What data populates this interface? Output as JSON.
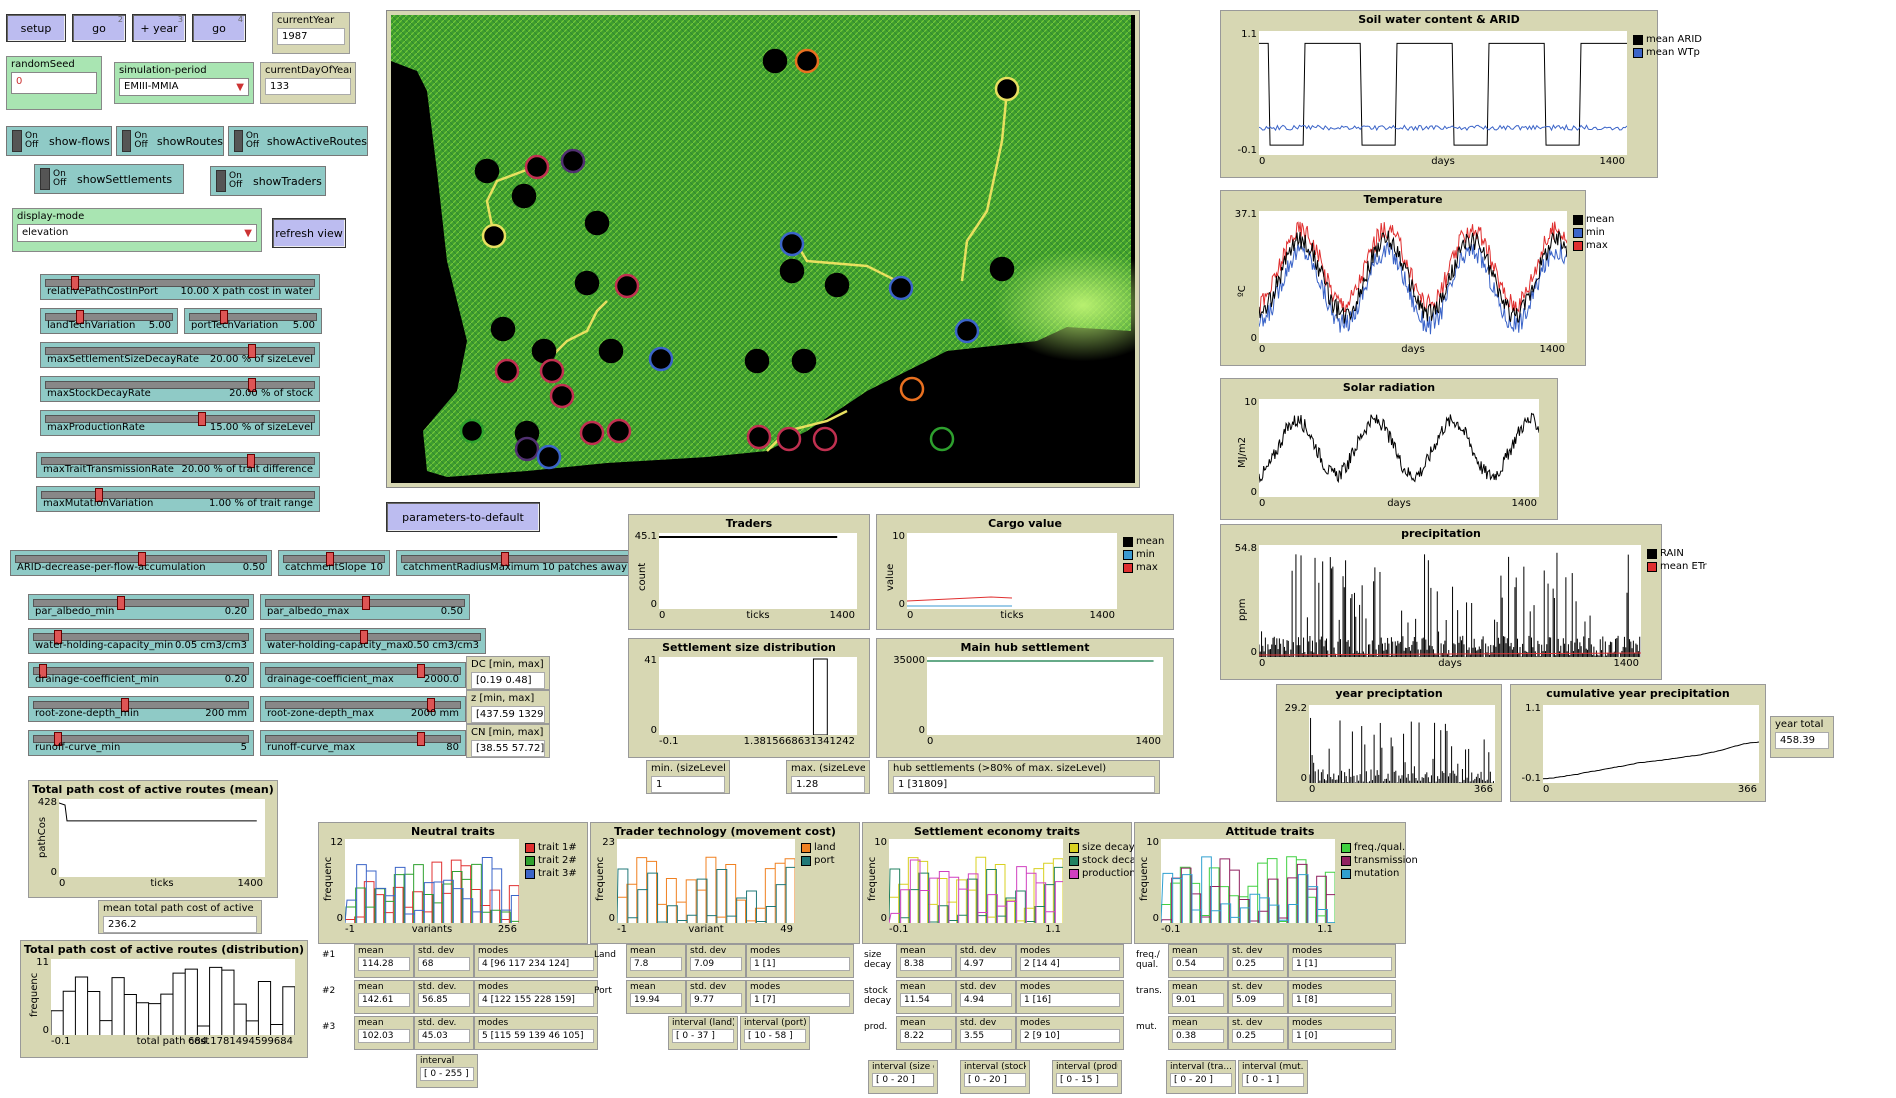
{
  "buttons": {
    "setup": "setup",
    "go": "go",
    "go_key": "2",
    "plus_year": "+ year",
    "plus_year_key": "3",
    "go_forever": "go",
    "go_forever_key": "4",
    "refresh": "refresh view",
    "defaults": "parameters-to-default"
  },
  "monitors": {
    "currentYear": {
      "label": "currentYear",
      "value": "1987"
    },
    "currentDay": {
      "label": "currentDayOfYear",
      "value": "133"
    },
    "yearTotal": {
      "label": "year total",
      "value": "458.39"
    },
    "minSize": {
      "label": "min. (sizeLevel)",
      "value": "1"
    },
    "maxSize": {
      "label": "max. (sizeLevel)",
      "value": "1.28"
    },
    "hub": {
      "label": "hub settlements (>80% of max. sizeLevel)",
      "value": "1 [31809]"
    },
    "meanPath": {
      "label": "mean total path cost of active routes",
      "value": "236.2"
    },
    "DC": {
      "label": "DC [min, max]",
      "value": "[0.19 0.48]"
    },
    "z": {
      "label": "z [min, max]",
      "value": "[437.59 1329.36]"
    },
    "CN": {
      "label": "CN [min, max]",
      "value": "[38.55 57.72]"
    }
  },
  "inputs": {
    "randomSeed": {
      "label": "randomSeed",
      "value": "0"
    }
  },
  "choosers": {
    "period": {
      "label": "simulation-period",
      "value": "EMIII-MMIA"
    },
    "display": {
      "label": "display-mode",
      "value": "elevation"
    }
  },
  "switches": {
    "on": "On",
    "off": "Off",
    "flows": "show-flows",
    "routes": "showRoutes",
    "active": "showActiveRoutes",
    "settlements": "showSettlements",
    "traders": "showTraders"
  },
  "sliders": {
    "s1": {
      "name": "relativePathCostInPort",
      "value": "10.00 X path cost in water",
      "level": 0.1
    },
    "s2": {
      "name": "landTechVariation",
      "value": "5.00",
      "level": 0.25
    },
    "s3": {
      "name": "portTechVariation",
      "value": "5.00",
      "level": 0.25
    },
    "s4": {
      "name": "maxSettlementSizeDecayRate",
      "value": "20.00 % of sizeLevel",
      "level": 0.77
    },
    "s5": {
      "name": "maxStockDecayRate",
      "value": "20.00 % of stock",
      "level": 0.77
    },
    "s6": {
      "name": "maxProductionRate",
      "value": "15.00 % of sizeLevel",
      "level": 0.58
    },
    "s7": {
      "name": "maxTraitTransmissionRate",
      "value": "20.00 % of trait difference",
      "level": 0.77
    },
    "s8": {
      "name": "maxMutationVariation",
      "value": "1.00 % of trait range",
      "level": 0.2
    },
    "s9": {
      "name": "ARID-decrease-per-flow-accumulation",
      "value": "0.50",
      "level": 0.5
    },
    "s10": {
      "name": "catchmentSlope",
      "value": "10",
      "level": 0.45
    },
    "s11": {
      "name": "catchmentRadiusMaximum",
      "value": "10 patches away",
      "level": 0.45
    },
    "s12": {
      "name": "par_albedo_min",
      "value": "0.20",
      "level": 0.4
    },
    "s13": {
      "name": "par_albedo_max",
      "value": "0.50",
      "level": 0.5
    },
    "s14": {
      "name": "water-holding-capacity_min",
      "value": "0.05 cm3/cm3",
      "level": 0.1
    },
    "s15": {
      "name": "water-holding-capacity_max",
      "value": "0.50 cm3/cm3",
      "level": 0.45
    },
    "s16": {
      "name": "drainage-coefficient_min",
      "value": "0.20",
      "level": 0.03
    },
    "s17": {
      "name": "drainage-coefficient_max",
      "value": "2000.0",
      "level": 0.8
    },
    "s18": {
      "name": "root-zone-depth_min",
      "value": "200 mm",
      "level": 0.42
    },
    "s19": {
      "name": "root-zone-depth_max",
      "value": "2000 mm",
      "level": 0.85
    },
    "s20": {
      "name": "runoff-curve_min",
      "value": "5",
      "level": 0.1
    },
    "s21": {
      "name": "runoff-curve_max",
      "value": "80",
      "level": 0.8
    }
  },
  "plots": {
    "soil": {
      "title": "Soil water content & ARID",
      "ymax": "1.1",
      "ymin": "-0.1",
      "xmin": "0",
      "xmax": "1400",
      "xlabel": "days",
      "legend": [
        {
          "name": "mean ARID",
          "color": "#000000"
        },
        {
          "name": "mean WTp",
          "color": "#3b64c8"
        }
      ]
    },
    "temp": {
      "title": "Temperature",
      "ymax": "37.1",
      "ymin": "0",
      "xmin": "0",
      "xmax": "1400",
      "xlabel": "days",
      "ylabel": "ºC",
      "legend": [
        {
          "name": "mean",
          "color": "#000000"
        },
        {
          "name": "min",
          "color": "#3b64c8"
        },
        {
          "name": "max",
          "color": "#e03030"
        }
      ]
    },
    "solar": {
      "title": "Solar radiation",
      "ymax": "10",
      "ymin": "0",
      "xmin": "0",
      "xmax": "1400",
      "xlabel": "days",
      "ylabel": "MJ/m2"
    },
    "precip": {
      "title": "precipitation",
      "ymax": "54.8",
      "ymin": "0",
      "xmin": "0",
      "xmax": "1400",
      "xlabel": "days",
      "ylabel": "ppm",
      "legend": [
        {
          "name": "RAIN",
          "color": "#000000"
        },
        {
          "name": "mean ETr",
          "color": "#e03030"
        }
      ]
    },
    "yearPrecip": {
      "title": "year preciptation",
      "ymax": "29.2",
      "ymin": "0",
      "xmin": "0",
      "xmax": "366"
    },
    "cumPrecip": {
      "title": "cumulative year precipitation",
      "ymax": "1.1",
      "ymin": "-0.1",
      "xmin": "0",
      "xmax": "366"
    },
    "traders": {
      "title": "Traders",
      "ymax": "45.1",
      "ymin": "0",
      "xmin": "0",
      "xmax": "1400",
      "xlabel": "ticks",
      "ylabel": "count"
    },
    "cargo": {
      "title": "Cargo value",
      "ymax": "10",
      "ymin": "0",
      "xmin": "0",
      "xmax": "1400",
      "xlabel": "ticks",
      "ylabel": "value",
      "legend": [
        {
          "name": "mean",
          "color": "#000000"
        },
        {
          "name": "min",
          "color": "#3b9ad0"
        },
        {
          "name": "max",
          "color": "#e03030"
        }
      ]
    },
    "sizeDist": {
      "title": "Settlement size distribution",
      "ymax": "41",
      "ymin": "0",
      "xmin": "-0.1",
      "xmax": "1.3815668631341242"
    },
    "hubPlot": {
      "title": "Main hub settlement",
      "ymax": "35000",
      "ymin": "0",
      "xmin": "0",
      "xmax": "1400"
    },
    "pathMean": {
      "title": "Total path cost of active routes (mean)",
      "ymax": "428",
      "ymin": "0",
      "xmin": "0",
      "xmax": "1400",
      "xlabel": "ticks",
      "ylabel": "pathCos"
    },
    "pathDist": {
      "title": "Total path cost of active routes (distribution)",
      "ymax": "11",
      "ymin": "0",
      "xmin": "-0.1",
      "xmax": "684.1781494599684",
      "xlabel": "total path cost",
      "ylabel": "frequenc"
    },
    "neutral": {
      "title": "Neutral traits",
      "ymax": "12",
      "ymin": "0",
      "xmin": "-1",
      "xmax": "256",
      "xlabel": "variants",
      "ylabel": "frequenc",
      "legend": [
        {
          "name": "trait 1#",
          "color": "#e03030"
        },
        {
          "name": "trait 2#",
          "color": "#2ea02e"
        },
        {
          "name": "trait 3#",
          "color": "#3b64c8"
        }
      ]
    },
    "tech": {
      "title": "Trader technology (movement cost)",
      "ymax": "23",
      "ymin": "0",
      "xmin": "-1",
      "xmax": "49",
      "xlabel": "variant",
      "ylabel": "frequenc",
      "legend": [
        {
          "name": "land",
          "color": "#f08020"
        },
        {
          "name": "port",
          "color": "#207878"
        }
      ]
    },
    "econ": {
      "title": "Settlement economy traits",
      "ymax": "10",
      "ymin": "0",
      "xmin": "-0.1",
      "xmax": "1.1",
      "ylabel": "frequenc",
      "legend": [
        {
          "name": "size decay",
          "color": "#d8d020"
        },
        {
          "name": "stock decay",
          "color": "#208060"
        },
        {
          "name": "production",
          "color": "#d040c0"
        }
      ]
    },
    "attitude": {
      "title": "Attitude traits",
      "ymax": "10",
      "ymin": "0",
      "xmin": "-0.1",
      "xmax": "1.1",
      "ylabel": "frequenc",
      "legend": [
        {
          "name": "freq./qual.",
          "color": "#40d040"
        },
        {
          "name": "transmission",
          "color": "#902060"
        },
        {
          "name": "mutation",
          "color": "#30a0d0"
        }
      ]
    }
  },
  "neutralStats": {
    "rowLabels": [
      "#1",
      "#2",
      "#3"
    ],
    "rows": [
      {
        "mean": "114.28",
        "sd_label": "std. dev",
        "sd": "68",
        "modes": "4 [96 117 234 124]"
      },
      {
        "mean": "142.61",
        "sd_label": "std. dev.",
        "sd": "56.85",
        "modes": "4 [122 155 228 159]"
      },
      {
        "mean": "102.03",
        "sd_label": "std. dev.",
        "sd": "45.03",
        "modes": "5 [115 59 139 46 105]"
      }
    ],
    "interval": "[ 0 - 255 ]",
    "interval_label": "interval"
  },
  "techStats": {
    "rowLabels": [
      "Land",
      "Port"
    ],
    "rows": [
      {
        "mean": "7.8",
        "sd": "7.09",
        "modes": "1 [1]"
      },
      {
        "mean": "19.94",
        "sd": "9.77",
        "modes": "1 [7]"
      }
    ],
    "intervals": [
      {
        "label": "interval (land)",
        "value": "[ 0 - 37 ]"
      },
      {
        "label": "interval (port)",
        "value": "[ 10 - 58 ]"
      }
    ]
  },
  "econStats": {
    "rowLabels": [
      "size\ndecay",
      "stock\ndecay",
      "prod."
    ],
    "rows": [
      {
        "mean": "8.38",
        "sd": "4.97",
        "modes": "2 [14 4]"
      },
      {
        "mean": "11.54",
        "sd": "4.94",
        "modes": "1 [16]"
      },
      {
        "mean": "8.22",
        "sd": "3.55",
        "modes": "2 [9 10]"
      }
    ],
    "intervals": [
      {
        "label": "interval (size dec...",
        "value": "[ 0 - 20 ]"
      },
      {
        "label": "interval (stock dec...",
        "value": "[ 0 - 20 ]"
      },
      {
        "label": "interval (producti...",
        "value": "[ 0 - 15 ]"
      }
    ]
  },
  "attStats": {
    "rowLabels": [
      "freq./\nqual.",
      "trans.",
      "mut."
    ],
    "rows": [
      {
        "mean": "0.54",
        "sd": "0.25",
        "modes": "1 [1]"
      },
      {
        "mean": "9.01",
        "sd": "5.09",
        "modes": "1 [8]"
      },
      {
        "mean": "0.38",
        "sd": "0.25",
        "modes": "1 [0]"
      }
    ],
    "intervals": [
      {
        "label": "interval (tra...",
        "value": "[ 0 - 20 ]"
      },
      {
        "label": "interval (mut.)",
        "value": "[ 0 - 1 ]"
      }
    ]
  },
  "stat_labels": {
    "mean": "mean",
    "sd": "std. dev",
    "sd2": "st. dev",
    "modes": "modes"
  }
}
